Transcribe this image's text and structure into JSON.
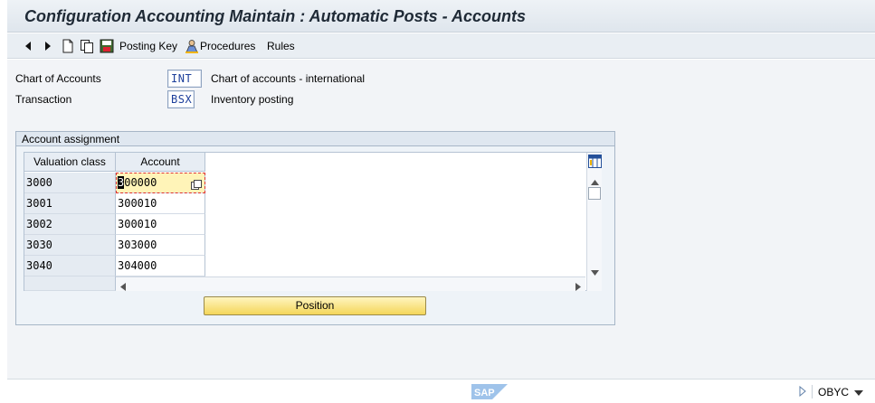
{
  "window": {
    "title": "Configuration Accounting Maintain : Automatic Posts - Accounts"
  },
  "toolbar": {
    "back_icon": "back-arrow-icon",
    "forward_icon": "forward-arrow-icon",
    "new_icon": "new-document-icon",
    "copy_icon": "copy-icon",
    "save_icon": "save-icon",
    "posting_key_label": "Posting Key",
    "procedures_icon": "procedures-icon",
    "procedures_label": "Procedures",
    "rules_label": "Rules"
  },
  "header": {
    "chart_of_accounts": {
      "label": "Chart of Accounts",
      "value": "INT",
      "description": "Chart of accounts - international"
    },
    "transaction": {
      "label": "Transaction",
      "value": "BSX",
      "description": "Inventory posting"
    }
  },
  "account_assignment": {
    "title": "Account assignment",
    "columns": [
      "Valuation class",
      "Account"
    ],
    "rows": [
      {
        "valuation_class": "3000",
        "account": "300000"
      },
      {
        "valuation_class": "3001",
        "account": "300010"
      },
      {
        "valuation_class": "3002",
        "account": "300010"
      },
      {
        "valuation_class": "3030",
        "account": "303000"
      },
      {
        "valuation_class": "3040",
        "account": "304000"
      }
    ],
    "active_cell_cursor_char": "3",
    "active_cell_rest": "00000",
    "column_settings_icon": "table-settings-icon",
    "position_button_label": "Position"
  },
  "status": {
    "logo": "SAP",
    "transaction_code": "OBYC"
  },
  "colors": {
    "field_value_text": "#1d3f9b",
    "button_yellow": "#f4d65a",
    "active_cell": "#fff4b8"
  }
}
